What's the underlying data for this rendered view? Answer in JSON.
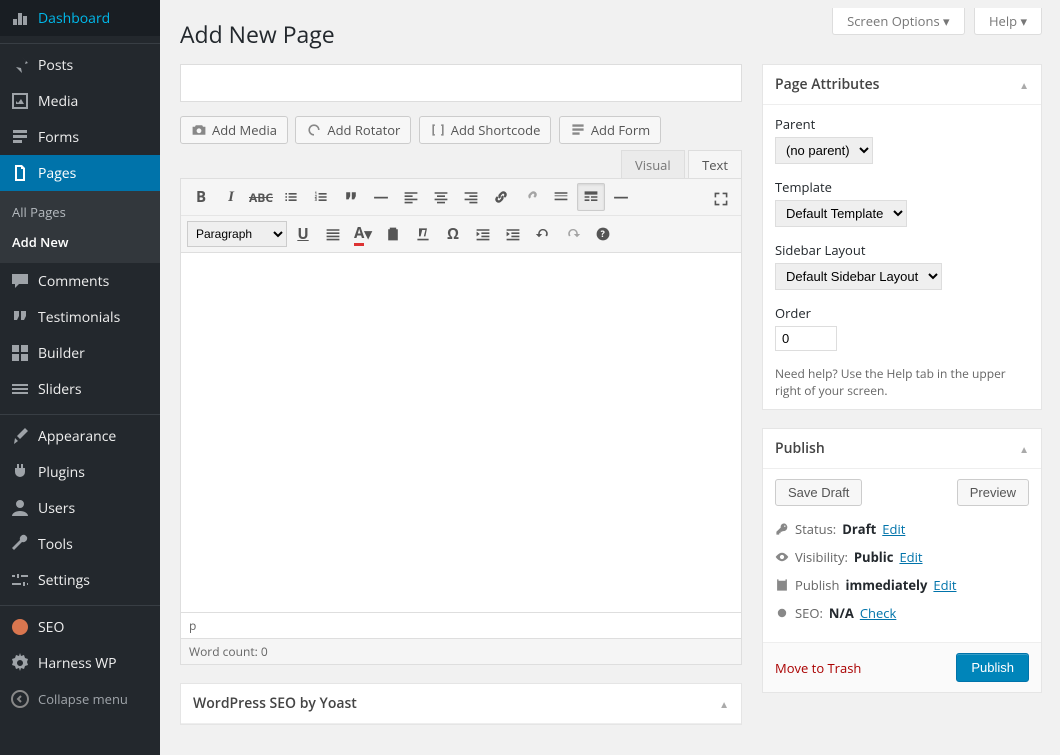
{
  "topTabs": {
    "screenOptions": "Screen Options",
    "help": "Help"
  },
  "pageTitle": "Add New Page",
  "sidebar": {
    "items": [
      {
        "id": "dashboard",
        "label": "Dashboard"
      },
      {
        "id": "posts",
        "label": "Posts"
      },
      {
        "id": "media",
        "label": "Media"
      },
      {
        "id": "forms",
        "label": "Forms"
      },
      {
        "id": "pages",
        "label": "Pages"
      },
      {
        "id": "comments",
        "label": "Comments"
      },
      {
        "id": "testimonials",
        "label": "Testimonials"
      },
      {
        "id": "builder",
        "label": "Builder"
      },
      {
        "id": "sliders",
        "label": "Sliders"
      },
      {
        "id": "appearance",
        "label": "Appearance"
      },
      {
        "id": "plugins",
        "label": "Plugins"
      },
      {
        "id": "users",
        "label": "Users"
      },
      {
        "id": "tools",
        "label": "Tools"
      },
      {
        "id": "settings",
        "label": "Settings"
      },
      {
        "id": "seo",
        "label": "SEO"
      },
      {
        "id": "harness",
        "label": "Harness WP"
      }
    ],
    "submenu": {
      "allPages": "All Pages",
      "addNew": "Add New"
    },
    "collapse": "Collapse menu"
  },
  "mediaButtons": {
    "addMedia": "Add Media",
    "addRotator": "Add Rotator",
    "addShortcode": "Add Shortcode",
    "addForm": "Add Form"
  },
  "editor": {
    "visualTab": "Visual",
    "textTab": "Text",
    "formatSelect": "Paragraph",
    "path": "p",
    "wordCountLabel": "Word count: 0"
  },
  "seoBox": {
    "title": "WordPress SEO by Yoast"
  },
  "pageAttr": {
    "title": "Page Attributes",
    "parentLabel": "Parent",
    "parentValue": "(no parent)",
    "templateLabel": "Template",
    "templateValue": "Default Template",
    "sidebarLabel": "Sidebar Layout",
    "sidebarValue": "Default Sidebar Layout",
    "orderLabel": "Order",
    "orderValue": "0",
    "help": "Need help? Use the Help tab in the upper right of your screen."
  },
  "publish": {
    "title": "Publish",
    "saveDraft": "Save Draft",
    "preview": "Preview",
    "statusLabel": "Status:",
    "statusValue": "Draft",
    "visibilityLabel": "Visibility:",
    "visibilityValue": "Public",
    "publishLabel": "Publish",
    "publishValue": "immediately",
    "seoLabel": "SEO:",
    "seoValue": "N/A",
    "edit": "Edit",
    "check": "Check",
    "trash": "Move to Trash",
    "publishBtn": "Publish"
  }
}
